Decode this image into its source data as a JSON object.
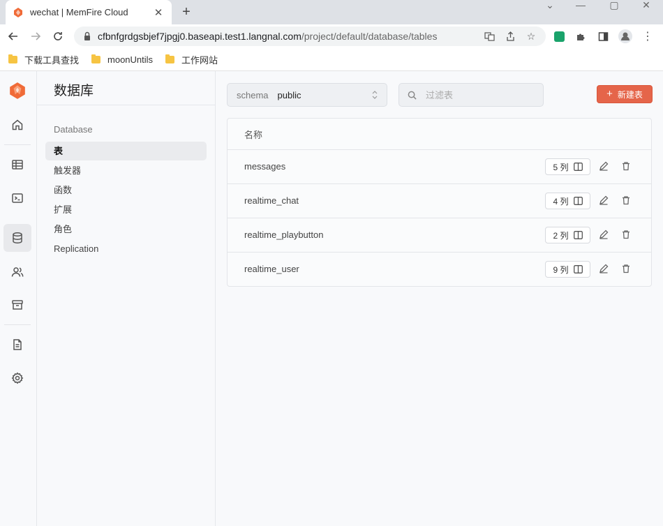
{
  "browser": {
    "tab_title": "wechat | MemFire Cloud",
    "url_host": "cfbnfgrdgsbjef7jpgj0.baseapi.test1.langnal.com",
    "url_path": "/project/default/database/tables",
    "bookmarks": [
      {
        "label": "下载工具查找"
      },
      {
        "label": "moonUntils"
      },
      {
        "label": "工作网站"
      }
    ]
  },
  "nav": {
    "title": "数据库",
    "section": "Database",
    "items": [
      {
        "label": "表",
        "active": true
      },
      {
        "label": "触发器"
      },
      {
        "label": "函数"
      },
      {
        "label": "扩展"
      },
      {
        "label": "角色"
      },
      {
        "label": "Replication"
      }
    ]
  },
  "main": {
    "schema_label": "schema",
    "schema_value": "public",
    "filter_placeholder": "过滤表",
    "new_table_label": "新建表",
    "table_header": "名称",
    "rows": [
      {
        "name": "messages",
        "cols": "5 列"
      },
      {
        "name": "realtime_chat",
        "cols": "4 列"
      },
      {
        "name": "realtime_playbutton",
        "cols": "2 列"
      },
      {
        "name": "realtime_user",
        "cols": "9 列"
      }
    ]
  },
  "colors": {
    "accent": "#e5654a",
    "logo": "#f06b38"
  }
}
